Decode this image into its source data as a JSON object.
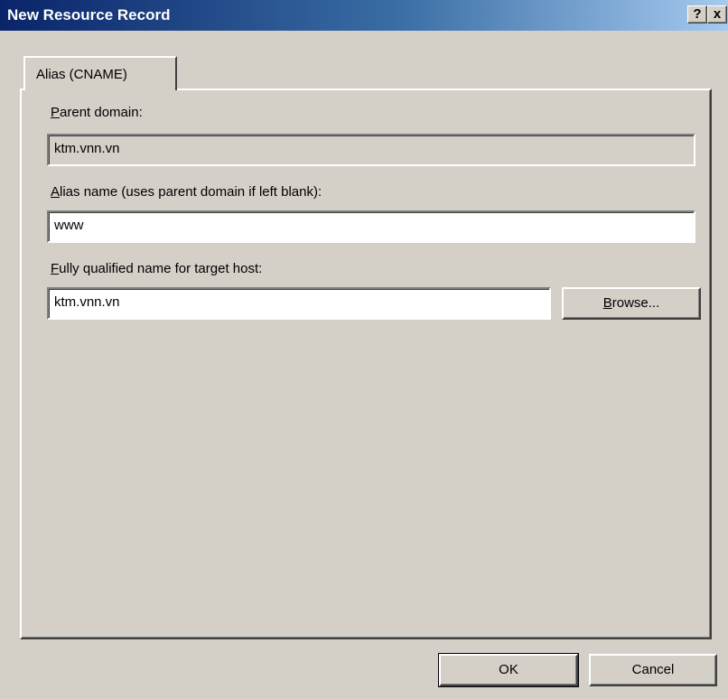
{
  "window": {
    "title": "New Resource Record",
    "help_button": "?",
    "close_button": "x"
  },
  "tab": {
    "label": "Alias (CNAME)"
  },
  "parent_domain": {
    "label_accel": "P",
    "label_rest": "arent domain:",
    "value": "ktm.vnn.vn"
  },
  "alias_name": {
    "label_accel": "A",
    "label_rest": "lias name (uses parent domain if left blank):",
    "value": "www"
  },
  "target_host": {
    "label_accel": "F",
    "label_rest": "ully qualified name for target host:",
    "value": "ktm.vnn.vn"
  },
  "browse_button": {
    "accel": "B",
    "rest": "rowse..."
  },
  "buttons": {
    "ok": "OK",
    "cancel": "Cancel"
  }
}
